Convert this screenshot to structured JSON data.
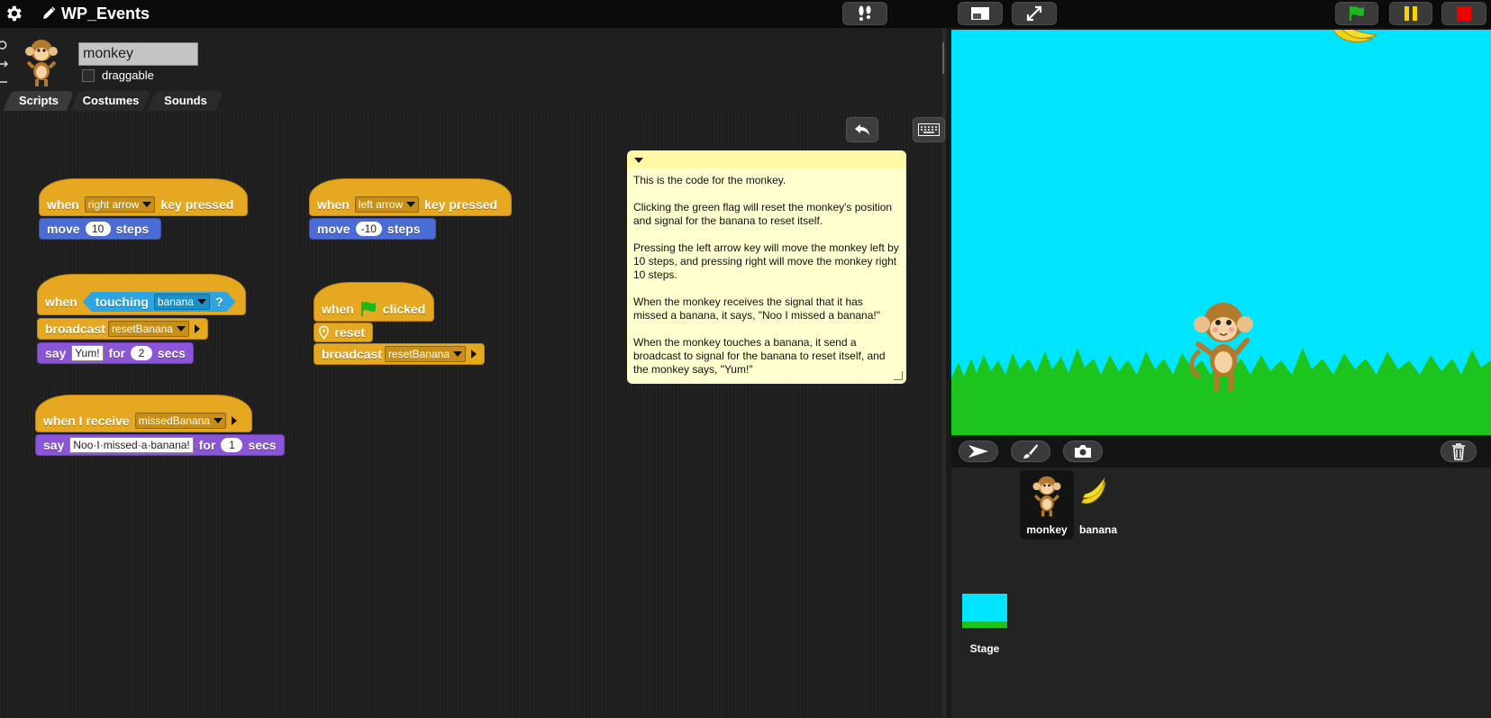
{
  "app": {
    "project_title": "WP_Events"
  },
  "sprite": {
    "name": "monkey",
    "draggable_label": "draggable",
    "draggable_checked": false
  },
  "tabs": [
    {
      "label": "Scripts",
      "active": true
    },
    {
      "label": "Costumes",
      "active": false
    },
    {
      "label": "Sounds",
      "active": false
    }
  ],
  "scripts": {
    "s1": {
      "when": "when",
      "key": "right arrow",
      "key_pressed": "key pressed",
      "move": "move",
      "steps_value": "10",
      "steps": "steps"
    },
    "s2": {
      "when": "when",
      "key": "left arrow",
      "key_pressed": "key pressed",
      "move": "move",
      "steps_value": "-10",
      "steps": "steps"
    },
    "s3": {
      "when": "when",
      "touching": "touching",
      "target": "banana",
      "q": "?",
      "broadcast": "broadcast",
      "message": "resetBanana",
      "say": "say",
      "say_text": "Yum!",
      "for": "for",
      "secs_value": "2",
      "secs": "secs"
    },
    "s4": {
      "when": "when",
      "clicked": "clicked",
      "reset": "reset",
      "broadcast": "broadcast",
      "message": "resetBanana"
    },
    "s5": {
      "when_receive": "when I receive",
      "message": "missedBanana",
      "say": "say",
      "say_text": "Noo·I·missed·a·banana!",
      "for": "for",
      "secs_value": "1",
      "secs": "secs"
    }
  },
  "comment": {
    "p1": "This is the code for the monkey.",
    "p2": "Clicking the green flag will reset the monkey's position and signal for the banana to reset itself.",
    "p3": "Pressing the left arrow key will move the monkey left by 10 steps, and pressing right will move the monkey right 10 steps.",
    "p4": "When the monkey receives the signal that it has missed a banana, it says, \"Noo I missed a banana!\"",
    "p5": "When the monkey touches a banana, it send a broadcast to signal for the banana to reset itself, and the monkey says, \"Yum!\""
  },
  "corral": {
    "sprites": [
      {
        "name": "monkey",
        "selected": true
      },
      {
        "name": "banana",
        "selected": false
      }
    ],
    "stage_label": "Stage"
  },
  "colors": {
    "events": "#e6a821",
    "motion": "#4a6cd4",
    "looks": "#8a55d7",
    "sensing": "#2ca5e2",
    "stage_sky": "#00e5ff",
    "grass": "#1ec41e",
    "comment": "#ffffcf"
  },
  "icons": [
    "gear-icon",
    "pencil-icon",
    "footprints-icon",
    "stage-size-icon",
    "fullscreen-icon",
    "green-flag-icon",
    "pause-icon",
    "stop-icon",
    "undo-icon",
    "keyboard-icon",
    "turtle-icon",
    "paintbrush-icon",
    "camera-icon",
    "trash-icon"
  ]
}
